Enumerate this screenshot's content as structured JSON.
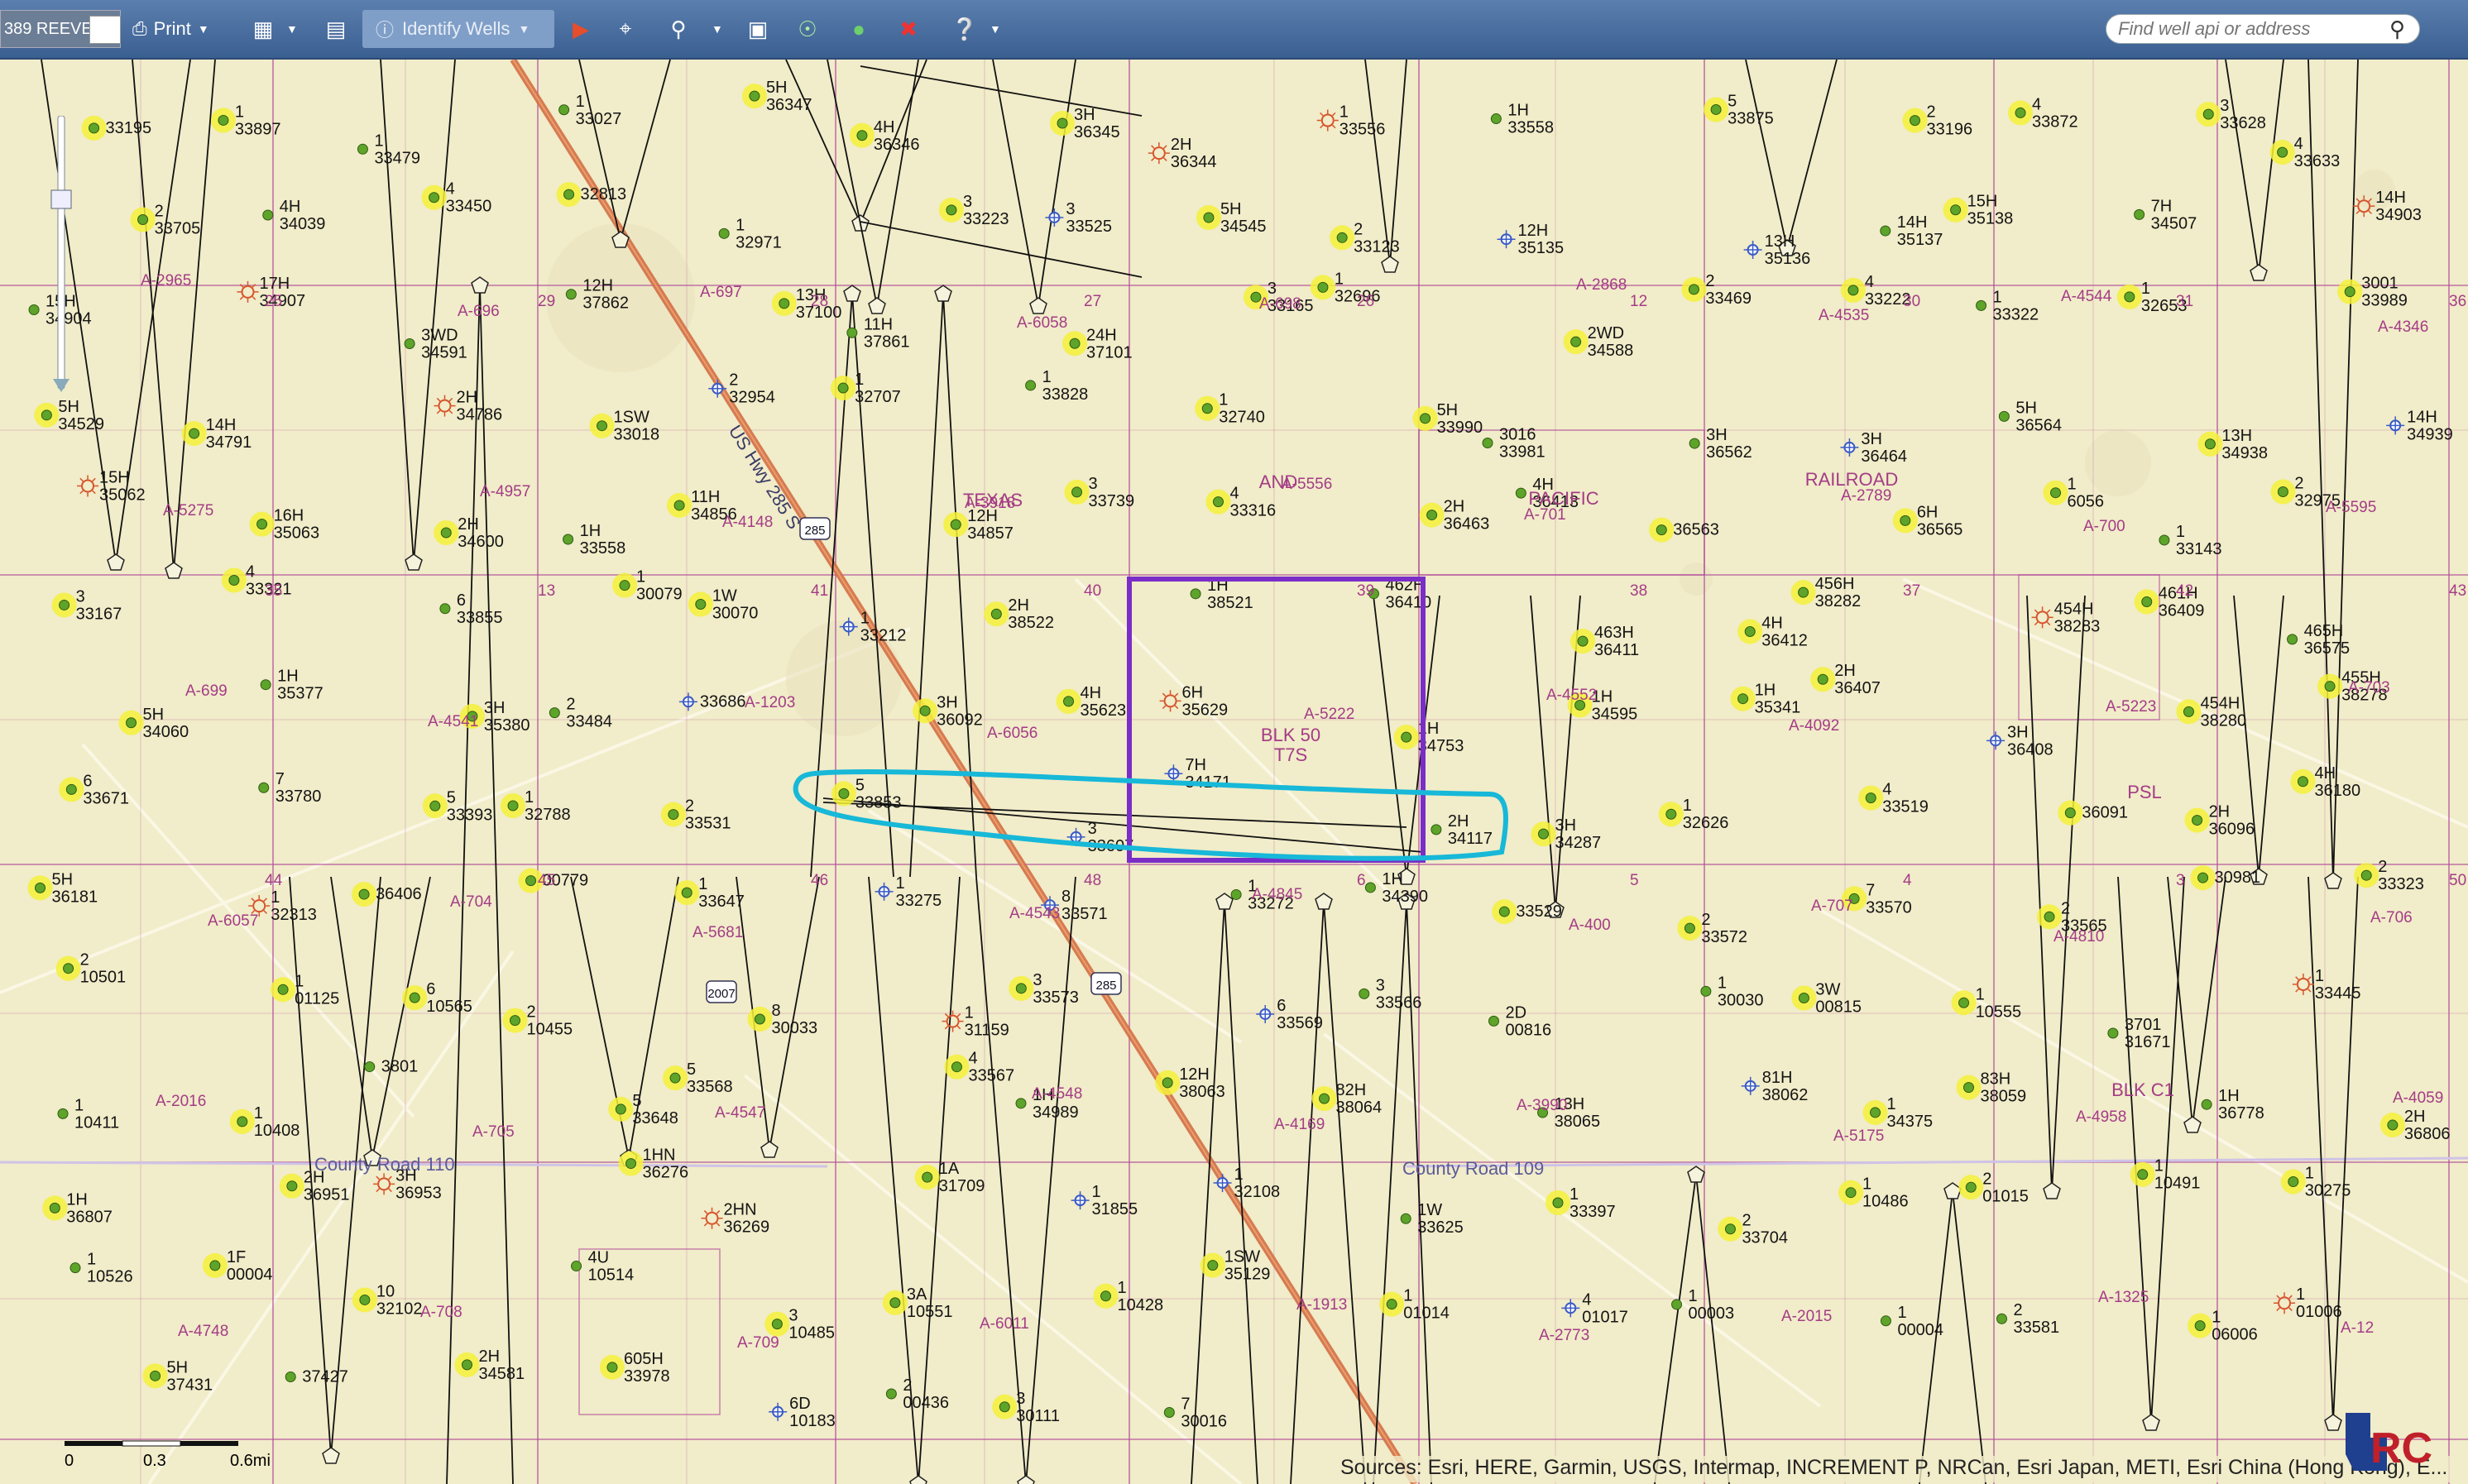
{
  "toolbar": {
    "county_value": "389 REEVES",
    "print_label": "Print",
    "identify_label": "Identify Wells",
    "search_placeholder": "Find well api or address",
    "icons": [
      "printer-icon",
      "grid-icon",
      "layers-icon",
      "info-icon",
      "arrow-icon",
      "crosshair-icon",
      "zoom-icon",
      "fullextent-icon",
      "target-icon",
      "globe-icon",
      "clear-icon",
      "help-icon"
    ]
  },
  "colors": {
    "map_bg": "#f1ecc9",
    "survey_line": "#b04a9a",
    "survey_label": "#a43c86",
    "highway": "#d26f45",
    "well_line": "#111111",
    "permit_glow": "#f5f13a",
    "producing_dot": "#5ea32a",
    "cyan_annotation": "#17b8d8",
    "purple_annotation": "#7a2ec7"
  },
  "map": {
    "area_labels": [
      "TEXAS",
      "AND",
      "PACIFIC",
      "RAILROAD",
      "PSL",
      "BLK C1",
      "BLK 50",
      "T7S"
    ],
    "abstracts": [
      "A-2965",
      "A-696",
      "A-697",
      "A-6058",
      "A-698",
      "A-2868",
      "A-4535",
      "A-4544",
      "A-4346",
      "A-5275",
      "A-4957",
      "A-4148",
      "A-3918",
      "A-5556",
      "A-701",
      "A-2789",
      "A-700",
      "A-5595",
      "A-699",
      "A-4541",
      "A-1203",
      "A-6056",
      "A-5222",
      "A-4552",
      "A-4092",
      "A-5223",
      "A-703",
      "A-6057",
      "A-704",
      "A-5681",
      "A-4543",
      "A-4845",
      "A-400",
      "A-707",
      "A-4810",
      "A-706",
      "A-2016",
      "A-705",
      "A-4547",
      "A-4548",
      "A-4169",
      "A-3990",
      "A-5175",
      "A-4958",
      "A-4059",
      "A-4748",
      "A-708",
      "A-709",
      "A-6011",
      "A-1913",
      "A-2773",
      "A-2015",
      "A-1325",
      "A-12"
    ],
    "sections": [
      "25",
      "29",
      "28",
      "27",
      "26",
      "12",
      "30",
      "31",
      "36",
      "35",
      "13",
      "41",
      "40",
      "39",
      "38",
      "37",
      "42",
      "43",
      "44",
      "45",
      "46",
      "48",
      "6",
      "5",
      "4",
      "3",
      "50"
    ],
    "roads": [
      "US Hwy 285 S",
      "County Road 110",
      "County Road 109"
    ],
    "shields": [
      "285",
      "2007",
      "285"
    ],
    "wells": [
      {
        "t": "33195"
      },
      {
        "t": "1\n33897"
      },
      {
        "t": "1\n33479"
      },
      {
        "t": "1\n33027"
      },
      {
        "t": "5H\n36347"
      },
      {
        "t": "4H\n36346"
      },
      {
        "t": "3H\n36345"
      },
      {
        "t": "2H\n36344"
      },
      {
        "t": "1\n33556"
      },
      {
        "t": "1H\n33558"
      },
      {
        "t": "5\n33875"
      },
      {
        "t": "2\n33196"
      },
      {
        "t": "4\n33872"
      },
      {
        "t": "3\n33628"
      },
      {
        "t": "4\n33633"
      },
      {
        "t": "2\n33705"
      },
      {
        "t": "4H\n34039"
      },
      {
        "t": "4\n33450"
      },
      {
        "t": "32813"
      },
      {
        "t": "1\n32971"
      },
      {
        "t": "3\n33223"
      },
      {
        "t": "3\n33525"
      },
      {
        "t": "5H\n34545"
      },
      {
        "t": "2\n33123"
      },
      {
        "t": "12H\n35135"
      },
      {
        "t": "13H\n35136"
      },
      {
        "t": "14H\n35137"
      },
      {
        "t": "15H\n35138"
      },
      {
        "t": "7H\n34507"
      },
      {
        "t": "14H\n34903"
      },
      {
        "t": "15H\n34904"
      },
      {
        "t": "17H\n34907"
      },
      {
        "t": "3WD\n34591"
      },
      {
        "t": "12H\n37862"
      },
      {
        "t": "13H\n37100"
      },
      {
        "t": "11H\n37861"
      },
      {
        "t": "24H\n37101"
      },
      {
        "t": "3\n33165"
      },
      {
        "t": "1\n32696"
      },
      {
        "t": "2WD\n34588"
      },
      {
        "t": "2\n33469"
      },
      {
        "t": "4\n33222"
      },
      {
        "t": "1\n33322"
      },
      {
        "t": "1\n32653"
      },
      {
        "t": "3001\n33989"
      },
      {
        "t": "5H\n34529"
      },
      {
        "t": "14H\n34791"
      },
      {
        "t": "2H\n34786"
      },
      {
        "t": "1SW\n33018"
      },
      {
        "t": "2\n32954"
      },
      {
        "t": "1\n32707"
      },
      {
        "t": "1\n33828"
      },
      {
        "t": "1\n32740"
      },
      {
        "t": "5H\n33990"
      },
      {
        "t": "3016\n33981"
      },
      {
        "t": "3H\n36562"
      },
      {
        "t": "3H\n36464"
      },
      {
        "t": "5H\n36564"
      },
      {
        "t": "13H\n34938"
      },
      {
        "t": "14H\n34939"
      },
      {
        "t": "15H\n35062"
      },
      {
        "t": "16H\n35063"
      },
      {
        "t": "2H\n34600"
      },
      {
        "t": "1H\n33558"
      },
      {
        "t": "11H\n34856"
      },
      {
        "t": "12H\n34857"
      },
      {
        "t": "3\n33739"
      },
      {
        "t": "4\n33316"
      },
      {
        "t": "2H\n36463"
      },
      {
        "t": "4H\n36413"
      },
      {
        "t": "36563"
      },
      {
        "t": "6H\n36565"
      },
      {
        "t": "1\n6056"
      },
      {
        "t": "1\n33143"
      },
      {
        "t": "2\n32975"
      },
      {
        "t": "3\n33167"
      },
      {
        "t": "4\n33321"
      },
      {
        "t": "6\n33855"
      },
      {
        "t": "1\n30079"
      },
      {
        "t": "1W\n30070"
      },
      {
        "t": "1\n33212"
      },
      {
        "t": "2H\n38522"
      },
      {
        "t": "1H\n38521"
      },
      {
        "t": "462H\n36410"
      },
      {
        "t": "463H\n36411"
      },
      {
        "t": "4H\n36412"
      },
      {
        "t": "456H\n38282"
      },
      {
        "t": "454H\n38283"
      },
      {
        "t": "461H\n36409"
      },
      {
        "t": "465H\n36575"
      },
      {
        "t": "5H\n34060"
      },
      {
        "t": "1H\n35377"
      },
      {
        "t": "3H\n35380"
      },
      {
        "t": "2\n33484"
      },
      {
        "t": "33686"
      },
      {
        "t": "3H\n36092"
      },
      {
        "t": "4H\n35623"
      },
      {
        "t": "6H\n35629"
      },
      {
        "t": "1H\n34753"
      },
      {
        "t": "1H\n34595"
      },
      {
        "t": "1H\n35341"
      },
      {
        "t": "2H\n36407"
      },
      {
        "t": "3H\n36408"
      },
      {
        "t": "454H\n38280"
      },
      {
        "t": "455H\n38278"
      },
      {
        "t": "6\n33671"
      },
      {
        "t": "7\n33780"
      },
      {
        "t": "5\n33393"
      },
      {
        "t": "1\n32788"
      },
      {
        "t": "2\n33531"
      },
      {
        "t": "5\n33853"
      },
      {
        "t": "3\n33607"
      },
      {
        "t": "7H\n34171"
      },
      {
        "t": "2H\n34117"
      },
      {
        "t": "3H\n34287"
      },
      {
        "t": "1\n32626"
      },
      {
        "t": "4\n33519"
      },
      {
        "t": "36091"
      },
      {
        "t": "2H\n36096"
      },
      {
        "t": "4H\n36180"
      },
      {
        "t": "5H\n36181"
      },
      {
        "t": "1\n32313"
      },
      {
        "t": "36406"
      },
      {
        "t": "00779"
      },
      {
        "t": "1\n33647"
      },
      {
        "t": "1\n33275"
      },
      {
        "t": "8\n33571"
      },
      {
        "t": "1\n33272"
      },
      {
        "t": "1H\n34390"
      },
      {
        "t": "33529"
      },
      {
        "t": "2\n33572"
      },
      {
        "t": "7\n33570"
      },
      {
        "t": "2\n33565"
      },
      {
        "t": "30981"
      },
      {
        "t": "2\n33323"
      },
      {
        "t": "2\n10501"
      },
      {
        "t": "1\n01125"
      },
      {
        "t": "6\n10565"
      },
      {
        "t": "2\n10455"
      },
      {
        "t": "8\n30033"
      },
      {
        "t": "1\n31159"
      },
      {
        "t": "3\n33573"
      },
      {
        "t": "6\n33569"
      },
      {
        "t": "3\n33566"
      },
      {
        "t": "2D\n00816"
      },
      {
        "t": "1\n30030"
      },
      {
        "t": "3W\n00815"
      },
      {
        "t": "1\n10555"
      },
      {
        "t": "3701\n31671"
      },
      {
        "t": "1\n33445"
      },
      {
        "t": "1\n10411"
      },
      {
        "t": "1\n10408"
      },
      {
        "t": "3801"
      },
      {
        "t": "5\n33648"
      },
      {
        "t": "5\n33568"
      },
      {
        "t": "4\n33567"
      },
      {
        "t": "1H\n34989"
      },
      {
        "t": "12H\n38063"
      },
      {
        "t": "82H\n38064"
      },
      {
        "t": "13H\n38065"
      },
      {
        "t": "81H\n38062"
      },
      {
        "t": "1\n34375"
      },
      {
        "t": "83H\n38059"
      },
      {
        "t": "1H\n36778"
      },
      {
        "t": "2H\n36806"
      },
      {
        "t": "1H\n36807"
      },
      {
        "t": "2H\n36951"
      },
      {
        "t": "3H\n36953"
      },
      {
        "t": "1HN\n36276"
      },
      {
        "t": "2HN\n36269"
      },
      {
        "t": "1A\n31709"
      },
      {
        "t": "1\n31855"
      },
      {
        "t": "1\n32108"
      },
      {
        "t": "1W\n33625"
      },
      {
        "t": "1\n33397"
      },
      {
        "t": "2\n33704"
      },
      {
        "t": "1\n10486"
      },
      {
        "t": "2\n01015"
      },
      {
        "t": "1\n10491"
      },
      {
        "t": "1\n30275"
      },
      {
        "t": "1\n10526"
      },
      {
        "t": "1F\n00004"
      },
      {
        "t": "10\n32102"
      },
      {
        "t": "4U\n10514"
      },
      {
        "t": "3\n10485"
      },
      {
        "t": "3A\n10551"
      },
      {
        "t": "1\n10428"
      },
      {
        "t": "1SW\n35129"
      },
      {
        "t": "1\n01014"
      },
      {
        "t": "4\n01017"
      },
      {
        "t": "1\n00003"
      },
      {
        "t": "1\n00004"
      },
      {
        "t": "2\n33581"
      },
      {
        "t": "1\n06006"
      },
      {
        "t": "1\n01006"
      },
      {
        "t": "5H\n37431"
      },
      {
        "t": "37427"
      },
      {
        "t": "2H\n34581"
      },
      {
        "t": "605H\n33978"
      },
      {
        "t": "6D\n10183"
      },
      {
        "t": "2\n00436"
      },
      {
        "t": "3\n30111"
      },
      {
        "t": "7\n30016"
      }
    ]
  },
  "zoom": {
    "label": "zoom slider"
  },
  "scalebar": {
    "t0": "0",
    "t1": "0.3",
    "t2": "0.6mi"
  },
  "attribution": "Sources: Esri, HERE, Garmin, USGS, Intermap, INCREMENT P, NRCan, Esri Japan, METI, Esri China (Hong Kong), E..."
}
